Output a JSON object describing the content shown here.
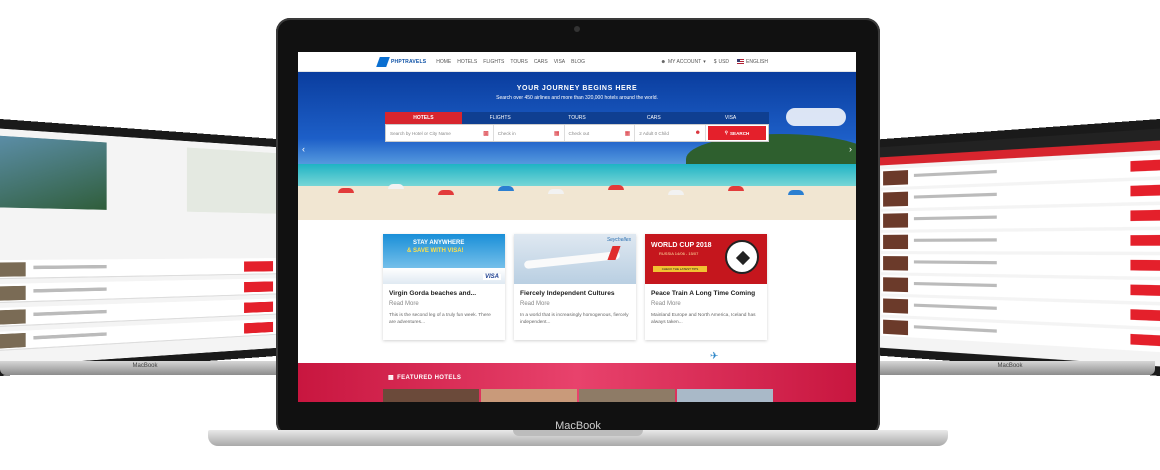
{
  "mock_window": {
    "device_label": "MacBook",
    "side_label_left": "MacBook",
    "side_label_right": "MacBook"
  },
  "nav": {
    "logo": "PHPTRAVELS",
    "links": [
      "HOME",
      "HOTELS",
      "FLIGHTS",
      "TOURS",
      "CARS",
      "VISA",
      "BLOG"
    ],
    "account": "MY ACCOUNT",
    "currency": "USD",
    "language": "ENGLISH"
  },
  "hero": {
    "title": "YOUR JOURNEY BEGINS HERE",
    "subtitle": "Search over 450 airlines and more than 320,000 hotels around the world.",
    "tabs": [
      "HOTELS",
      "FLIGHTS",
      "TOURS",
      "CARS",
      "VISA"
    ],
    "active_tab": "HOTELS",
    "fields": {
      "destination_placeholder": "Search by Hotel or City Name",
      "checkin_placeholder": "Check in",
      "checkout_placeholder": "Check out",
      "guests": "2 Adult 0 Child"
    },
    "search_button": "SEARCH"
  },
  "cards": [
    {
      "image_text_1": "STAY ANYWHERE",
      "image_text_2": "& SAVE WITH VISA!",
      "image_badge": "VISA",
      "title": "Virgin Gorda beaches and...",
      "read_more": "Read More",
      "excerpt": "This is the second leg of a truly fun week. There are adventures..."
    },
    {
      "image_text_1": "Seychelles",
      "title": "Fiercely Independent Cultures",
      "read_more": "Read More",
      "excerpt": "In a world that is increasingly homogenous, fiercely independent..."
    },
    {
      "image_text_1": "WORLD CUP 2018",
      "image_text_2": "RUSSIA 14/06 - 15/07",
      "image_button": "CHECK THE LATEST TIPS",
      "title": "Peace Train A Long Time Coming",
      "read_more": "Read More",
      "excerpt": "Mainland Europe and North America, Iceland has always taken..."
    }
  ],
  "featured": {
    "title": "FEATURED HOTELS"
  },
  "colors": {
    "brand_red": "#e4202b",
    "tab_blue": "#0f3f91",
    "featured_band": "#d62350"
  },
  "icons": {
    "account": "user-icon",
    "currency": "currency-icon",
    "language": "us-flag-icon",
    "search": "search-icon",
    "calendar": "calendar-icon",
    "guests": "person-icon",
    "featured": "hotel-icon",
    "prev": "chevron-left-icon",
    "next": "chevron-right-icon"
  }
}
